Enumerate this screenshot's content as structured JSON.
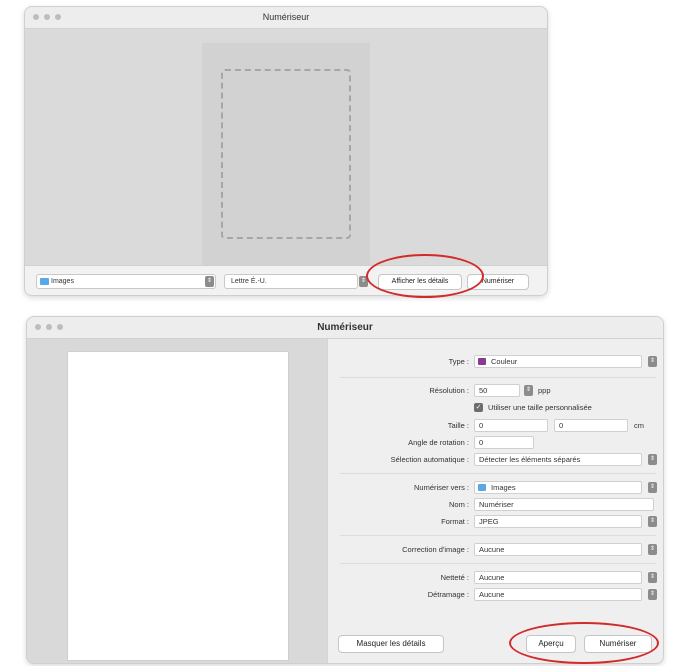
{
  "window1": {
    "title": "Numériseur",
    "bottom": {
      "destination": {
        "label": "Images",
        "icon": "folder-icon"
      },
      "paper_size": "Lettre É.-U.",
      "show_details": "Afficher les détails",
      "scan": "Numériser",
      "stepper_icon": "⇕"
    }
  },
  "window2": {
    "title": "Numériseur",
    "settings": {
      "type": {
        "label": "Type :",
        "value": "Couleur",
        "swatch": "#8a3a8f"
      },
      "resolution": {
        "label": "Résolution :",
        "value": "50",
        "unit": "ppp"
      },
      "custom_size": {
        "label": "Utiliser une taille personnalisée",
        "checked": true
      },
      "size": {
        "label": "Taille :",
        "width": "0",
        "height": "0",
        "unit": "cm"
      },
      "rotation": {
        "label": "Angle de rotation :",
        "value": "0"
      },
      "auto_select": {
        "label": "Sélection automatique :",
        "value": "Détecter les éléments séparés"
      },
      "scan_to": {
        "label": "Numériser vers :",
        "value": "Images"
      },
      "name": {
        "label": "Nom :",
        "value": "Numériser"
      },
      "format": {
        "label": "Format :",
        "value": "JPEG"
      },
      "image_correction": {
        "label": "Correction d'image :",
        "value": "Aucune"
      },
      "sharpness": {
        "label": "Netteté :",
        "value": "Aucune"
      },
      "descreening": {
        "label": "Détramage :",
        "value": "Aucune"
      }
    },
    "buttons": {
      "hide_details": "Masquer les détails",
      "preview": "Aperçu",
      "scan": "Numériser"
    },
    "check_glyph": "✓",
    "stepper_icon": "⇕"
  },
  "colors": {
    "highlight_ring": "#d42a2a",
    "folder": "#5aa9e6"
  }
}
